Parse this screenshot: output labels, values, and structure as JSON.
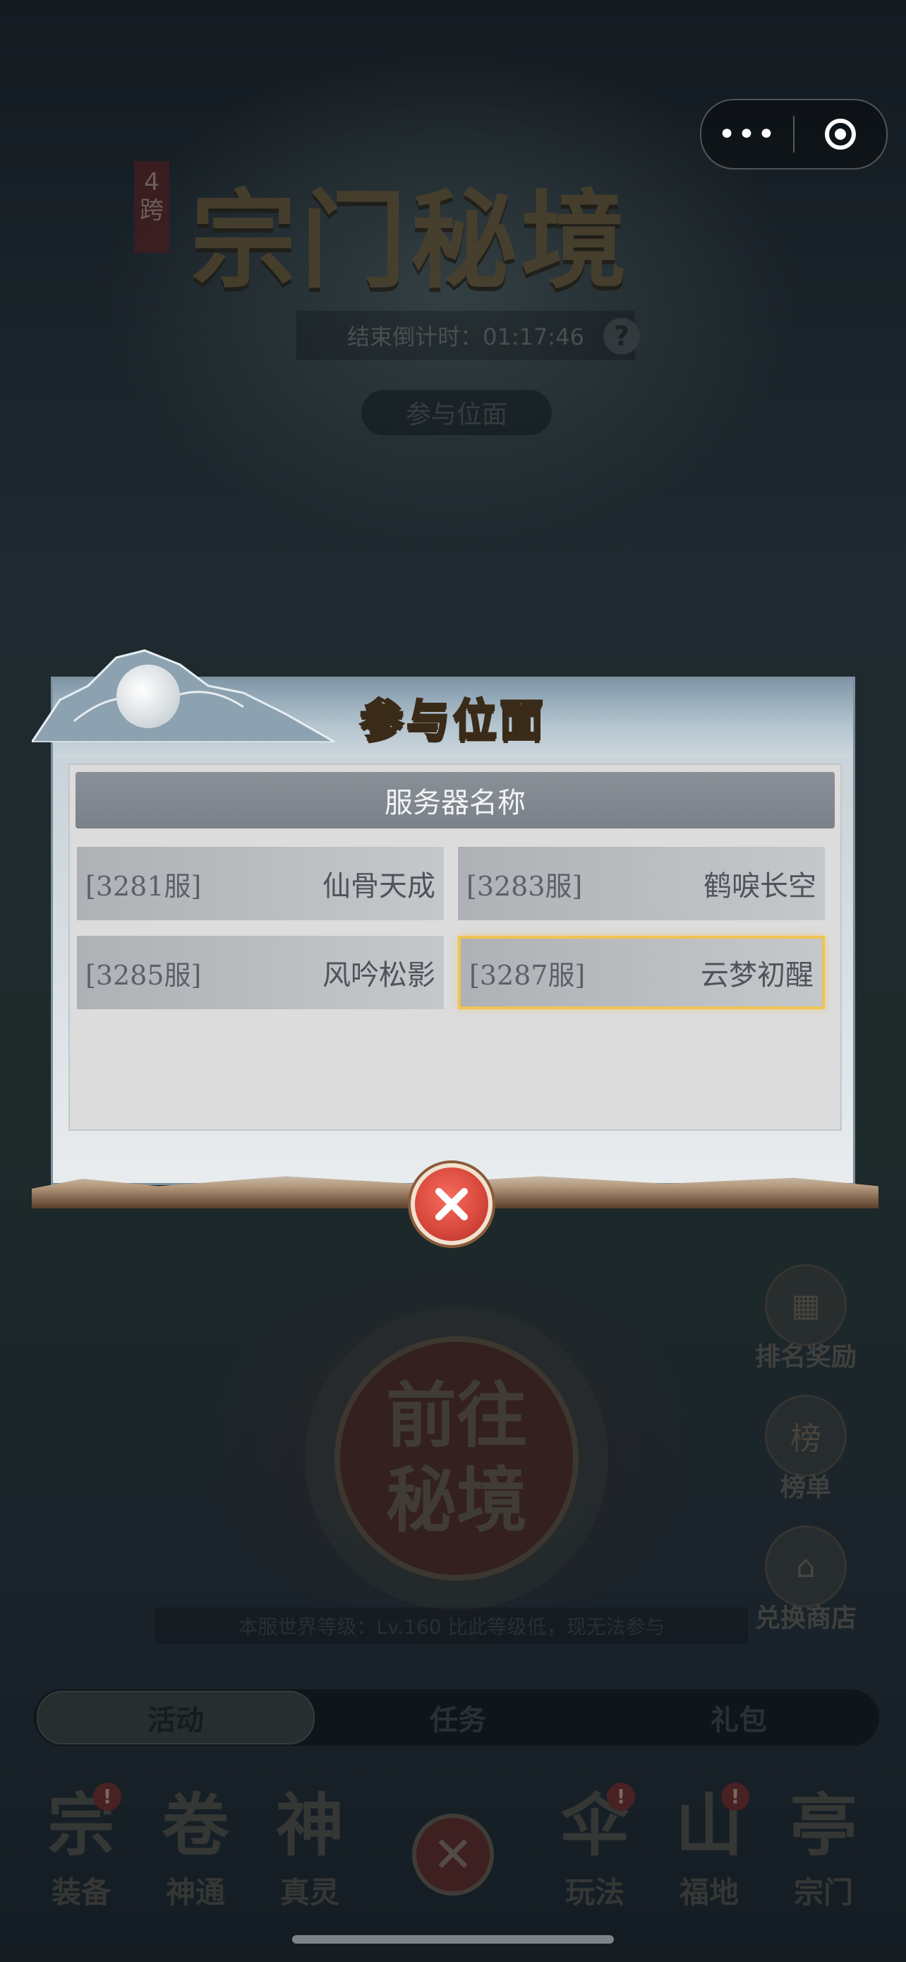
{
  "capsule": {
    "more_icon": "more-dots-icon",
    "record_icon": "record-icon",
    "more_text": "•••"
  },
  "background": {
    "cross_tag": "4跨",
    "title": "宗门秘境",
    "countdown": "结束倒计时：01:17:46",
    "help": "?",
    "participate_button": "参与位面",
    "goto_button": [
      "前往",
      "秘境"
    ],
    "world_level_text": "本服世界等级：Lv.160 比此等级低，现无法参与",
    "side_buttons": [
      {
        "label": "排名奖励",
        "icon": "gift-icon"
      },
      {
        "label": "榜单",
        "icon": "leaderboard-icon"
      },
      {
        "label": "兑换商店",
        "icon": "shop-icon"
      }
    ],
    "tabs": [
      "活动",
      "任务",
      "礼包"
    ],
    "nav": [
      {
        "label": "装备",
        "glyph": "宗",
        "badge": "!"
      },
      {
        "label": "神通",
        "glyph": "卷",
        "badge": ""
      },
      {
        "label": "真灵",
        "glyph": "神",
        "badge": ""
      },
      {
        "label": "玩法",
        "glyph": "伞",
        "badge": "!"
      },
      {
        "label": "福地",
        "glyph": "山",
        "badge": "!"
      },
      {
        "label": "宗门",
        "glyph": "亭",
        "badge": ""
      }
    ]
  },
  "dialog": {
    "title": "参与位面",
    "table_header": "服务器名称",
    "servers": [
      {
        "id": "[3281服]",
        "name": "仙骨天成",
        "selected": false
      },
      {
        "id": "[3283服]",
        "name": "鹤唳长空",
        "selected": false
      },
      {
        "id": "[3285服]",
        "name": "风吟松影",
        "selected": false
      },
      {
        "id": "[3287服]",
        "name": "云梦初醒",
        "selected": true
      }
    ]
  },
  "colors": {
    "accent_gold": "#f0c452",
    "close_red": "#d7463a",
    "title_gold": "#ffe9a8"
  }
}
